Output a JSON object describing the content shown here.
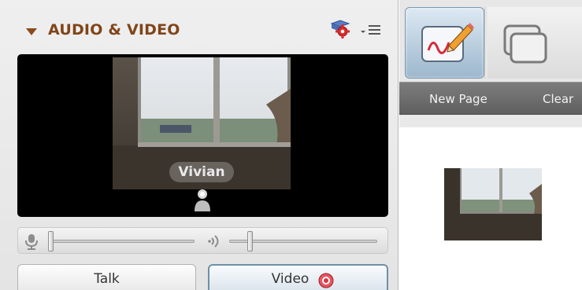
{
  "panel": {
    "title": "AUDIO & VIDEO",
    "icons": [
      "collapse-arrow-icon",
      "settings-gear-icon",
      "options-menu-icon"
    ]
  },
  "video": {
    "participant_name": "Vivian",
    "icons": [
      "participant-person-icon"
    ]
  },
  "audio": {
    "icons": [
      "microphone-icon",
      "speaker-icon"
    ]
  },
  "buttons": {
    "talk_label": "Talk",
    "video_label": "Video",
    "video_status_icon": "record-icon"
  },
  "whiteboard": {
    "new_page_label": "New Page",
    "clear_label": "Clear",
    "icons": [
      "whiteboard-pen-icon",
      "clear-pages-icon"
    ]
  },
  "colors": {
    "title": "#804519",
    "video_background": "#000000",
    "label_bar": "#6a6a6a",
    "record": "#d9363e",
    "accent_border": "#6f90a7"
  }
}
